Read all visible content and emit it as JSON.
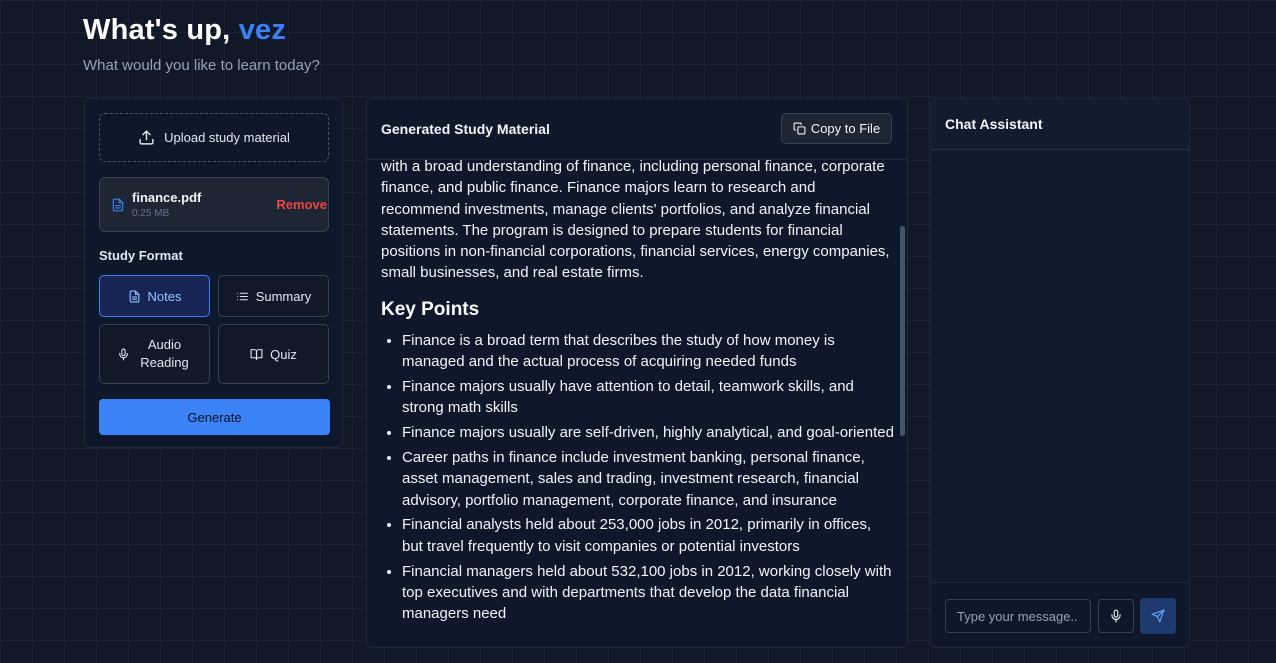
{
  "header": {
    "greeting_prefix": "What's up,",
    "username": "vez",
    "subtitle": "What would you like to learn today?"
  },
  "upload": {
    "label": "Upload study material"
  },
  "file": {
    "name": "finance.pdf",
    "size": "0.25 MB",
    "remove_label": "Remove"
  },
  "study_format": {
    "label": "Study Format",
    "options": [
      {
        "label": "Notes",
        "icon": "file-text-icon",
        "active": true
      },
      {
        "label": "Summary",
        "icon": "list-icon",
        "active": false
      },
      {
        "label": "Audio Reading",
        "icon": "mic-icon",
        "active": false
      },
      {
        "label": "Quiz",
        "icon": "book-open-icon",
        "active": false
      }
    ]
  },
  "generate": {
    "label": "Generate"
  },
  "material": {
    "title": "Generated Study Material",
    "copy_label": "Copy to File",
    "intro": "with a broad understanding of finance, including personal finance, corporate finance, and public finance. Finance majors learn to research and recommend investments, manage clients' portfolios, and analyze financial statements. The program is designed to prepare students for financial positions in non-financial corporations, financial services, energy companies, small businesses, and real estate firms.",
    "heading": "Key Points",
    "points": [
      "Finance is a broad term that describes the study of how money is managed and the actual process of acquiring needed funds",
      "Finance majors usually have attention to detail, teamwork skills, and strong math skills",
      "Finance majors usually are self-driven, highly analytical, and goal-oriented",
      "Career paths in finance include investment banking, personal finance, asset management, sales and trading, investment research, financial advisory, portfolio management, corporate finance, and insurance",
      "Financial analysts held about 253,000 jobs in 2012, primarily in offices, but travel frequently to visit companies or potential investors",
      "Financial managers held about 532,100 jobs in 2012, working closely with top executives and with departments that develop the data financial managers need"
    ]
  },
  "chat": {
    "title": "Chat Assistant",
    "input_placeholder": "Type your message.."
  },
  "colors": {
    "accent": "#3b82f6",
    "danger": "#ef4444",
    "background": "#111827",
    "panel": "#0f172a"
  }
}
